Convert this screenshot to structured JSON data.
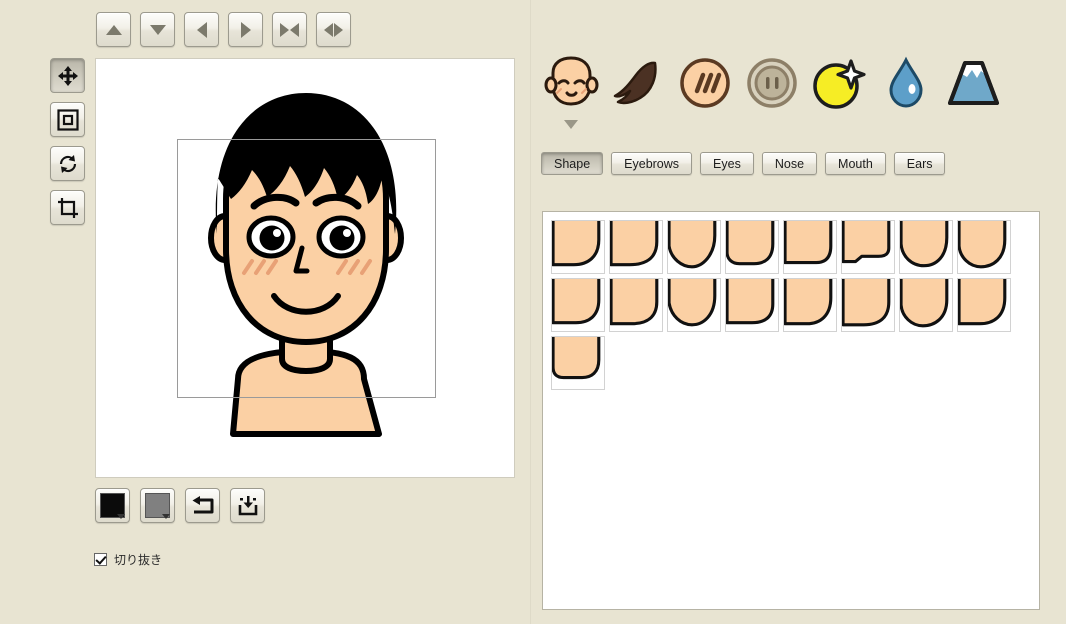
{
  "app": {
    "background_color": "#e8e4d2",
    "canvas_background": "#ffffff"
  },
  "top_toolbar": {
    "buttons": [
      {
        "name": "move-up-button",
        "icon": "triangle-up-icon",
        "label": "Move up"
      },
      {
        "name": "move-down-button",
        "icon": "triangle-down-icon",
        "label": "Move down"
      },
      {
        "name": "move-left-button",
        "icon": "triangle-left-icon",
        "label": "Move left"
      },
      {
        "name": "move-right-button",
        "icon": "triangle-right-icon",
        "label": "Move right"
      },
      {
        "name": "shrink-width-button",
        "icon": "arrows-inward-icon",
        "label": "Narrow"
      },
      {
        "name": "expand-width-button",
        "icon": "arrows-outward-icon",
        "label": "Widen"
      }
    ]
  },
  "left_tools": {
    "buttons": [
      {
        "name": "tool-move",
        "icon": "move-arrows-icon",
        "label": "Move",
        "selected": true
      },
      {
        "name": "tool-scale",
        "icon": "nested-square-icon",
        "label": "Scale",
        "selected": false
      },
      {
        "name": "tool-rotate",
        "icon": "rotate-arrows-icon",
        "label": "Rotate",
        "selected": false
      },
      {
        "name": "tool-crop",
        "icon": "crop-icon",
        "label": "Crop",
        "selected": false
      }
    ]
  },
  "canvas": {
    "selection_visible": true,
    "avatar": {
      "skin_color": "#fbd0a4",
      "hair_color": "#000000",
      "outline_color": "#000000",
      "blush_color": "#e8a176"
    }
  },
  "bottom_controls": {
    "line_color_swatch": {
      "name": "line-color-swatch",
      "color": "#0b0b0b",
      "label": "Line color"
    },
    "fill_color_swatch": {
      "name": "fill-color-swatch",
      "color": "#808080",
      "label": "Fill color"
    },
    "reset_button": {
      "name": "reset-button",
      "icon": "undo-arrow-icon",
      "label": "Reset"
    },
    "save_button": {
      "name": "save-button",
      "icon": "save-download-icon",
      "label": "Save"
    }
  },
  "crop_option": {
    "label": "切り抜き",
    "checked": true
  },
  "categories": {
    "selected_index": 0,
    "items": [
      {
        "name": "category-face",
        "icon": "baby-face-icon",
        "label": "Face"
      },
      {
        "name": "category-hair",
        "icon": "hair-icon",
        "label": "Hair"
      },
      {
        "name": "category-cheeks",
        "icon": "cheeks-icon",
        "label": "Cheeks"
      },
      {
        "name": "category-buttons",
        "icon": "button-icon",
        "label": "Button"
      },
      {
        "name": "category-moon",
        "icon": "moon-sparkle-icon",
        "label": "Moon"
      },
      {
        "name": "category-drop",
        "icon": "water-drop-icon",
        "label": "Drop"
      },
      {
        "name": "category-mountain",
        "icon": "mountain-icon",
        "label": "Mountain"
      }
    ]
  },
  "tabs": {
    "selected_index": 0,
    "items": [
      {
        "name": "tab-shape",
        "label": "Shape"
      },
      {
        "name": "tab-eyebrows",
        "label": "Eyebrows"
      },
      {
        "name": "tab-eyes",
        "label": "Eyes"
      },
      {
        "name": "tab-nose",
        "label": "Nose"
      },
      {
        "name": "tab-mouth",
        "label": "Mouth"
      },
      {
        "name": "tab-ears",
        "label": "Ears"
      }
    ]
  },
  "thumbnails": {
    "count": 17,
    "columns": 8,
    "item_label": "face-shape-option",
    "shapes": [
      "M0,0 L44,0 L44,20 C44,36 34,44 20,44 L0,44 Z",
      "M0,0 L44,0 L44,22 C44,38 33,44 18,44 L0,44 Z",
      "M0,0 L44,0 L44,16 C44,35 32,46 22,46 C12,46 2,38 0,26 Z",
      "M0,0 L44,0 L44,24 C44,38 36,43 26,43 L12,43 C4,43 0,38 0,32 Z",
      "M0,0 L44,0 L44,26 C44,38 38,42 30,42 L0,42 Z",
      "M0,0 L44,0 L44,28 C44,34 40,36 34,36 L18,36 L12,41 L0,41 Z",
      "M0,0 L44,0 L44,18 C44,36 34,45 22,45 C10,45 1,36 0,24 Z",
      "M0,0 L44,0 L44,20 C44,38 33,46 21,46 C10,46 1,37 0,26 Z",
      "M0,0 L44,0 L44,22 C44,37 35,44 22,44 L0,44 Z",
      "M0,0 L44,0 L44,24 C44,39 34,45 20,45 L0,45 Z",
      "M0,0 L44,0 L44,18 C44,37 33,46 22,46 C11,46 2,37 0,25 Z",
      "M0,0 L44,0 L44,26 C44,39 36,44 24,44 L0,44 Z",
      "M0,0 L44,0 L44,20 C44,37 34,45 21,45 L0,45 Z",
      "M0,0 L44,0 L44,24 C44,40 34,46 20,46 L0,46 Z",
      "M0,0 L44,0 L44,22 C44,40 32,47 21,47 C10,47 1,38 0,27 Z",
      "M0,0 L44,0 L44,20 C44,38 33,45 20,45 L0,45 Z",
      "M0,0 L44,0 L44,24 C44,36 37,41 28,41 L10,41 C3,41 0,37 0,31 Z"
    ]
  }
}
